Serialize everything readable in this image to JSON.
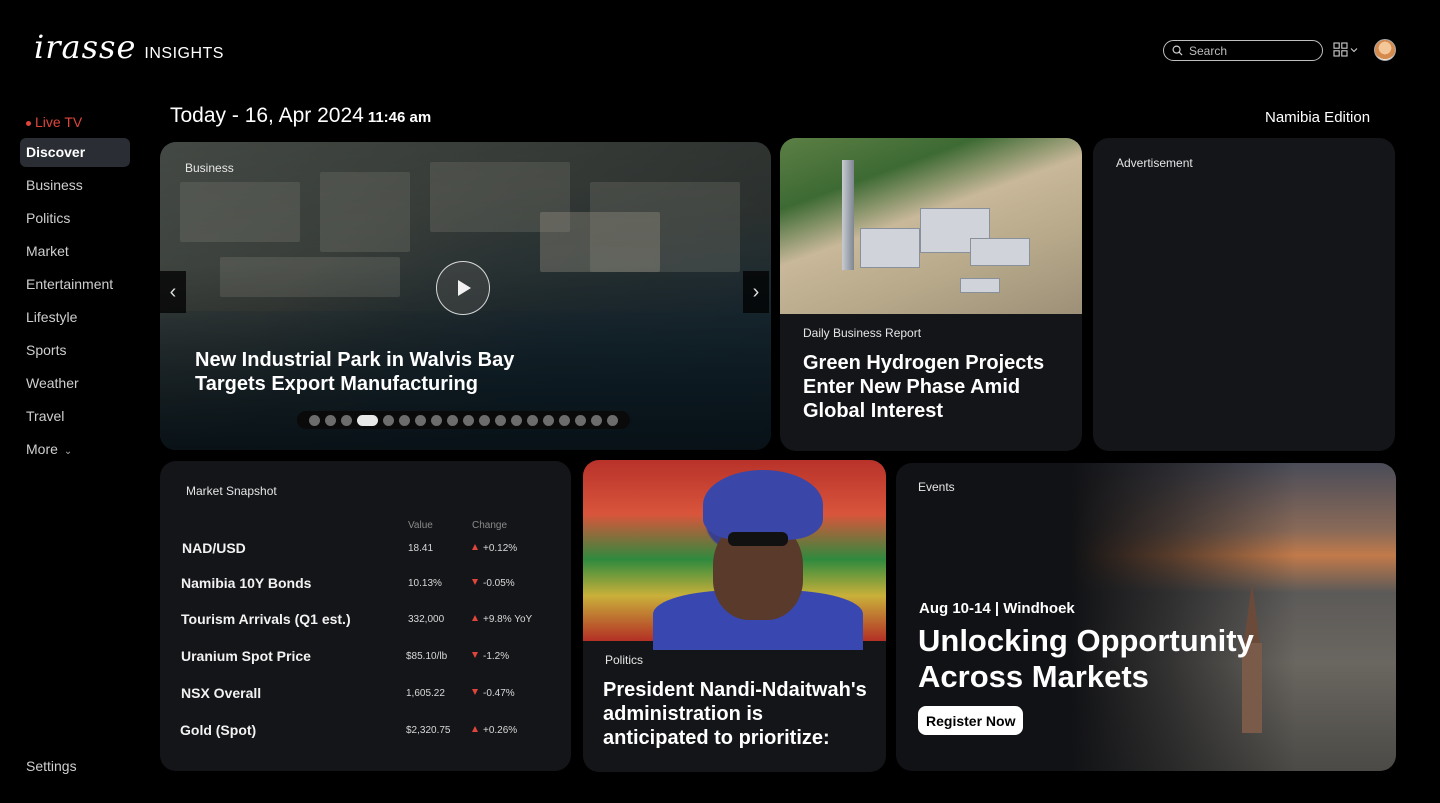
{
  "header": {
    "logo_main": "irasse",
    "logo_sub": "INSIGHTS",
    "search_placeholder": "Search"
  },
  "sidebar": {
    "items": [
      {
        "label": "Live TV"
      },
      {
        "label": "Discover"
      },
      {
        "label": "Business"
      },
      {
        "label": "Politics"
      },
      {
        "label": "Market"
      },
      {
        "label": "Entertainment"
      },
      {
        "label": "Lifestyle"
      },
      {
        "label": "Sports"
      },
      {
        "label": "Weather"
      },
      {
        "label": "Travel"
      },
      {
        "label": "More"
      }
    ],
    "settings": "Settings"
  },
  "dateline": {
    "date": "Today - 16, Apr 2024",
    "time": "11:46 am",
    "edition": "Namibia Edition"
  },
  "hero": {
    "tag": "Business",
    "title": "New Industrial Park in Walvis Bay Targets Export Manufacturing",
    "slides": 19,
    "active_slide": 4
  },
  "hydrogen": {
    "tag": "Daily Business Report",
    "title": "Green Hydrogen Projects Enter New Phase Amid Global Interest"
  },
  "ad": {
    "label": "Advertisement"
  },
  "market": {
    "title": "Market Snapshot",
    "col_value": "Value",
    "col_change": "Change",
    "rows": [
      {
        "name": "NAD/USD",
        "value": "18.41",
        "change": "+0.12%",
        "dir": "up"
      },
      {
        "name": "Namibia 10Y Bonds",
        "value": "10.13%",
        "change": "-0.05%",
        "dir": "down"
      },
      {
        "name": "Tourism Arrivals (Q1 est.)",
        "value": "332,000",
        "change": "+9.8% YoY",
        "dir": "up"
      },
      {
        "name": "Uranium Spot Price",
        "value": "$85.10/lb",
        "change": "-1.2%",
        "dir": "down"
      },
      {
        "name": "NSX Overall",
        "value": "1,605.22",
        "change": "-0.47%",
        "dir": "down"
      },
      {
        "name": "Gold (Spot)",
        "value": "$2,320.75",
        "change": "+0.26%",
        "dir": "up"
      }
    ]
  },
  "politics": {
    "tag": "Politics",
    "title": "President Nandi-Ndaitwah's administration is anticipated to prioritize:"
  },
  "events": {
    "tag": "Events",
    "date": "Aug 10-14 | Windhoek",
    "title": "Unlocking Opportunity Across Markets",
    "cta": "Register Now"
  },
  "colors": {
    "accent_live": "#e0453c",
    "card_bg": "#141518",
    "active_nav_bg": "#2a2d33"
  }
}
